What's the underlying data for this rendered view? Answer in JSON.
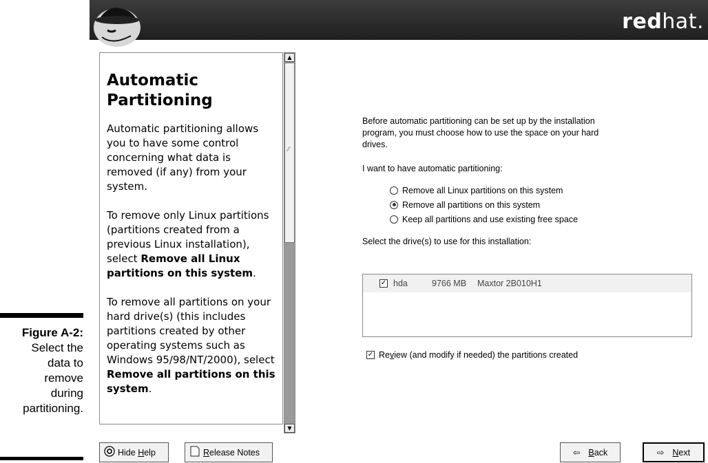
{
  "figure": {
    "label": "Figure A-2:",
    "caption_lines": [
      "Select the",
      "data to",
      "remove",
      "during",
      "partitioning."
    ]
  },
  "banner": {
    "brand_bold": "red",
    "brand_regular": "hat."
  },
  "help": {
    "title": "Automatic Partitioning",
    "p1": "Automatic partitioning allows you to have some control concerning what data is removed (if any) from your system.",
    "p2_before": "To remove only Linux partitions (partitions created from a previous Linux installation), select ",
    "p2_bold": "Remove all Linux partitions on this system",
    "p2_after": ".",
    "p3_before": "To remove all partitions on your hard drive(s) (this includes partitions created by other operating systems such as Windows 95/98/NT/2000), select ",
    "p3_bold": "Remove all partitions on this system",
    "p3_after": "."
  },
  "main": {
    "intro": "Before automatic partitioning can be set up by the installation program, you must choose how to use the space on your hard drives.",
    "want_label": "I want to have automatic partitioning:",
    "options": [
      {
        "label": "Remove all Linux partitions on this system",
        "selected": false
      },
      {
        "label": "Remove all partitions on this system",
        "selected": true
      },
      {
        "label": "Keep all partitions and use existing free space",
        "selected": false
      }
    ],
    "drives_label": "Select the drive(s) to use for this installation:",
    "drives": [
      {
        "name": "hda",
        "size": "9766 MB",
        "model": "Maxtor 2B010H1",
        "checked": true
      }
    ],
    "review": {
      "label_pre": "Re",
      "label_underlined": "v",
      "label_post": "iew (and modify if needed) the partitions created",
      "checked": true
    }
  },
  "buttons": {
    "hide_help_pre": "Hide ",
    "hide_help_mnemonic": "H",
    "hide_help_post": "elp",
    "release_notes_mnemonic": "R",
    "release_notes_post": "elease Notes",
    "back_mnemonic": "B",
    "back_post": "ack",
    "next_mnemonic": "N",
    "next_post": "ext"
  }
}
